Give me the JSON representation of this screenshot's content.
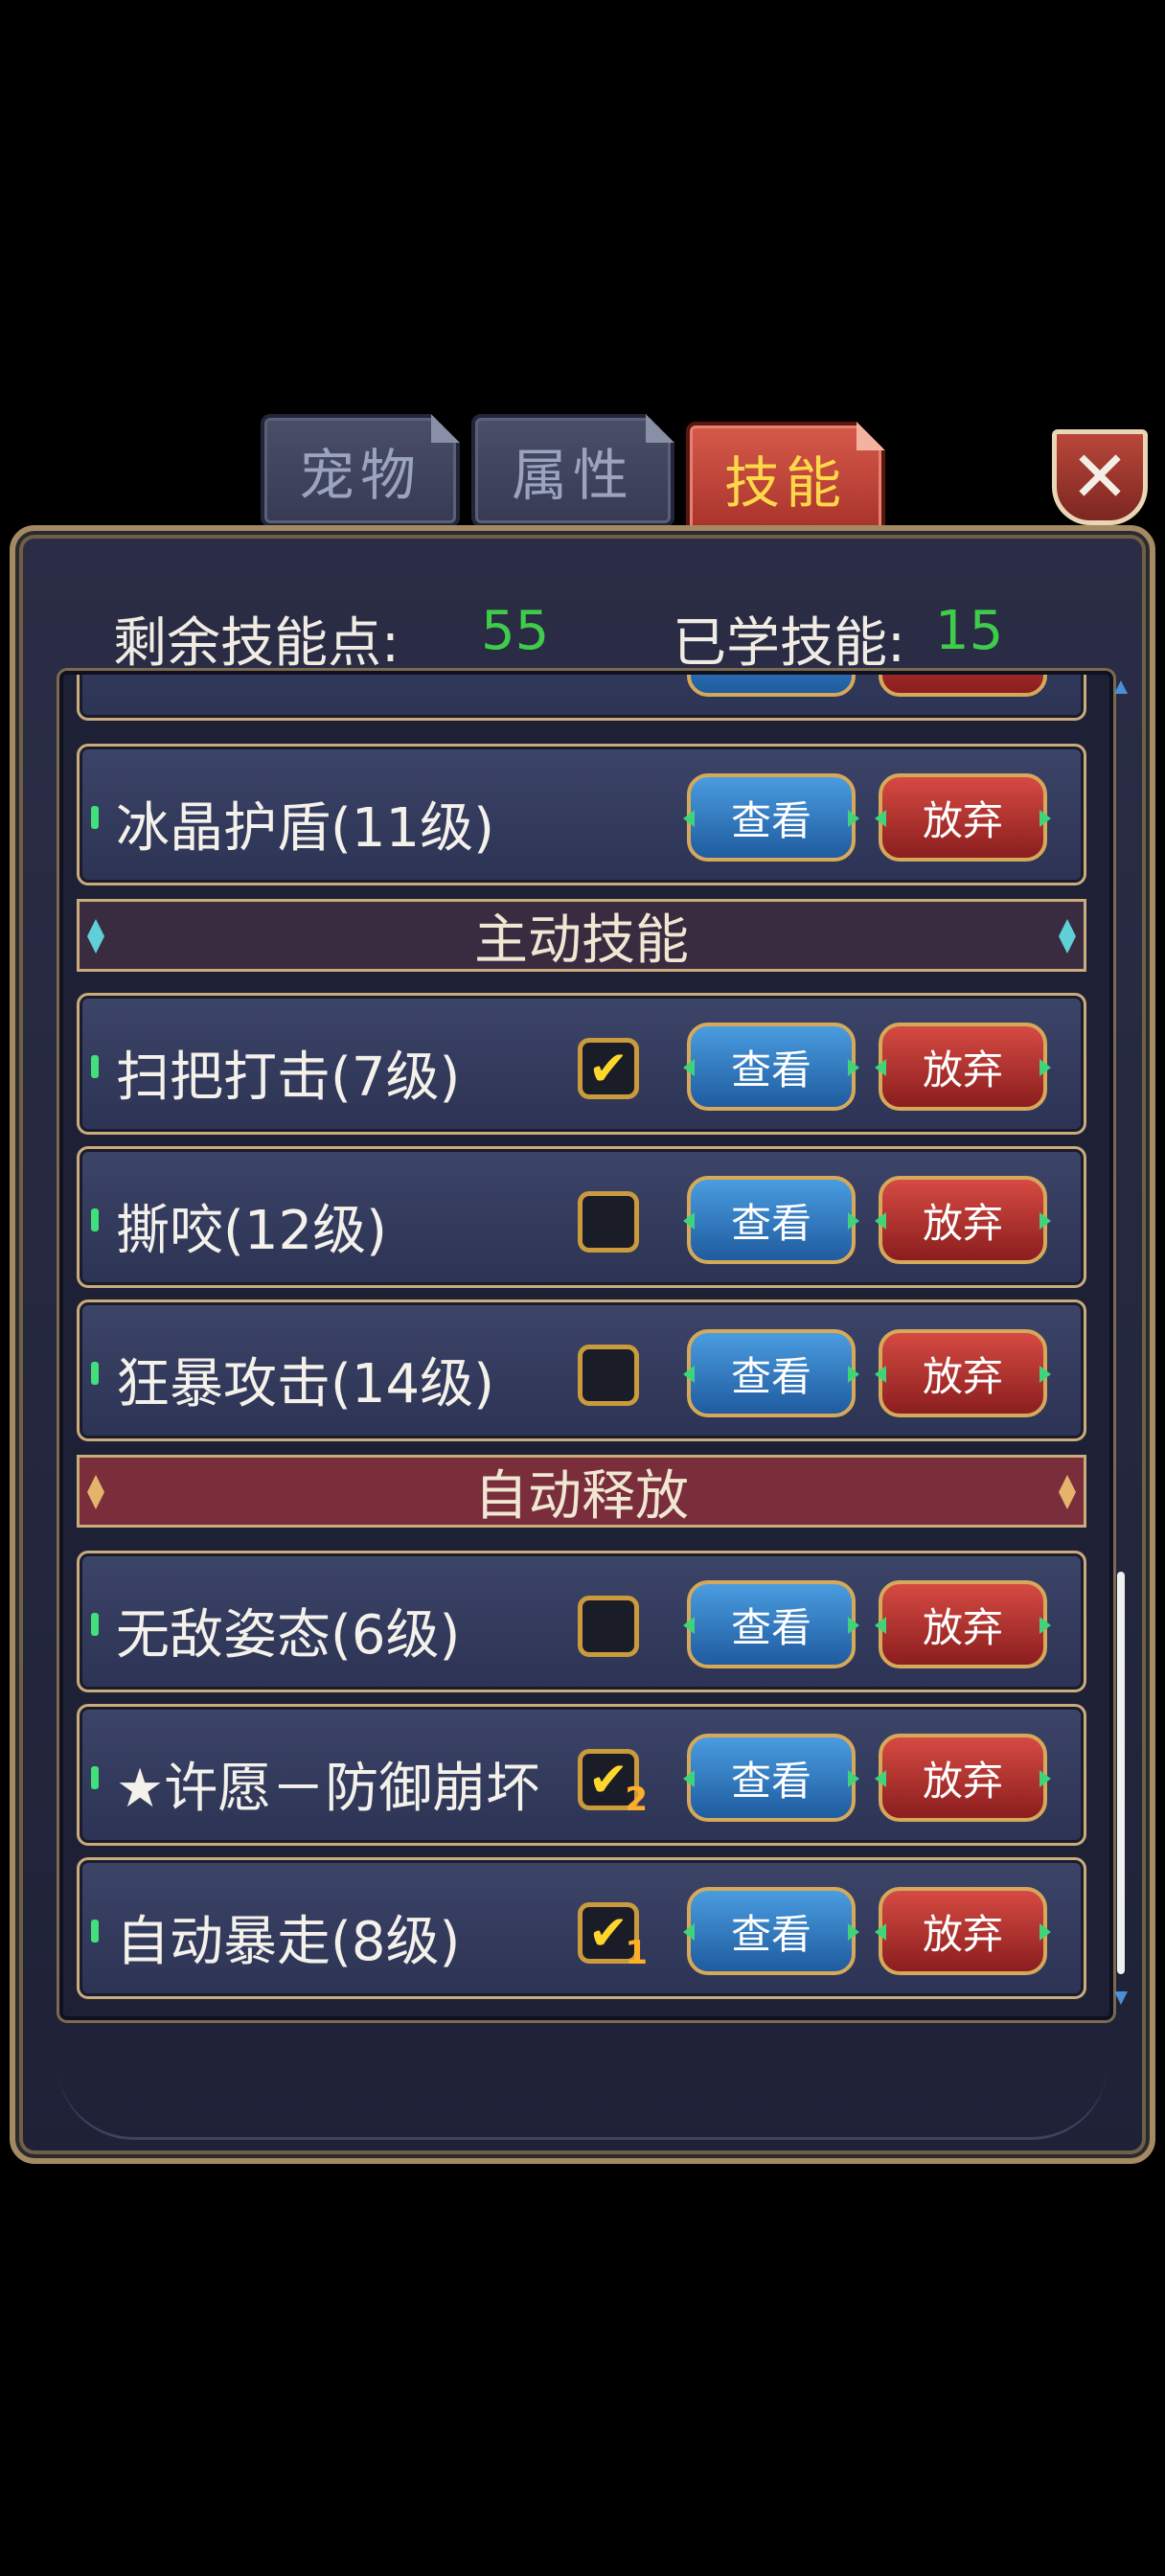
{
  "tabs": [
    {
      "label": "宠物",
      "active": false
    },
    {
      "label": "属性",
      "active": false
    },
    {
      "label": "技能",
      "active": true
    }
  ],
  "close": {
    "icon": "close-icon",
    "glyph": "✕"
  },
  "header": {
    "remaining_label": "剩余技能点:",
    "remaining_value": "55",
    "learned_label": "已学技能:",
    "learned_value": "15"
  },
  "buttons": {
    "view": "查看",
    "drop": "放弃"
  },
  "sections": {
    "active": "主动技能",
    "auto": "自动释放"
  },
  "passive_skills": [
    {
      "label": "冰晶护盾(11级)"
    }
  ],
  "active_skills": [
    {
      "label": "扫把打击(7级)",
      "checked": true,
      "badge": ""
    },
    {
      "label": "撕咬(12级)",
      "checked": false,
      "badge": ""
    },
    {
      "label": "狂暴攻击(14级)",
      "checked": false,
      "badge": ""
    }
  ],
  "auto_skills": [
    {
      "label": "无敌姿态(6级)",
      "checked": false,
      "badge": ""
    },
    {
      "label": "★许愿－防御崩坏",
      "checked": true,
      "badge": "2"
    },
    {
      "label": "自动暴走(8级)",
      "checked": true,
      "badge": "1"
    }
  ],
  "colors": {
    "accent_green": "#3fcc4a",
    "active_tab": "#c0443a",
    "gold_border": "#c9ab7c"
  }
}
